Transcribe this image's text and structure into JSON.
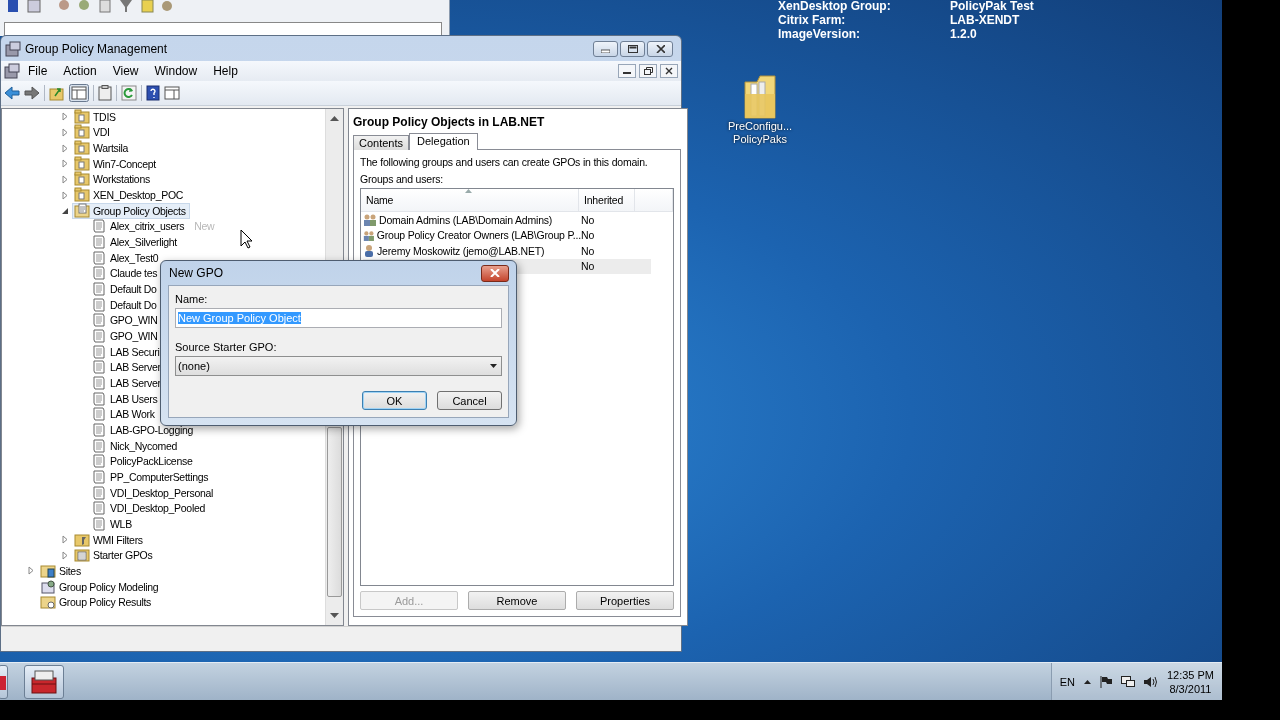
{
  "desktop_info": [
    {
      "label": "XenDesktop Group:",
      "value": "PolicyPak Test"
    },
    {
      "label": "Citrix Farm:",
      "value": "LAB-XENDT"
    },
    {
      "label": "ImageVersion:",
      "value": "1.2.0"
    }
  ],
  "desktop_icons": [
    {
      "label": "PreConfigu... PolicyPaks"
    }
  ],
  "window": {
    "title": "Group Policy Management",
    "menu": [
      "File",
      "Action",
      "View",
      "Window",
      "Help"
    ]
  },
  "tree": {
    "items": [
      {
        "kind": "continuation",
        "children": [
          {
            "label": "TDIS",
            "kind": "ou",
            "expanded": false,
            "selected": false
          },
          {
            "label": "VDI",
            "kind": "ou",
            "expanded": false,
            "selected": false
          },
          {
            "label": "Wartsila",
            "kind": "ou",
            "expanded": false,
            "selected": false
          },
          {
            "label": "Win7-Concept",
            "kind": "ou",
            "expanded": false,
            "selected": false
          },
          {
            "label": "Workstations",
            "kind": "ou",
            "expanded": false,
            "selected": false
          },
          {
            "label": "XEN_Desktop_POC",
            "kind": "ou",
            "expanded": false,
            "selected": false
          },
          {
            "label": "Group Policy Objects",
            "kind": "gpo_container",
            "expanded": true,
            "selected": true,
            "children": [
              {
                "label": "Alex_citrix_users",
                "kind": "gpo",
                "selected": false,
                "hint": "New"
              },
              {
                "label": "Alex_Silverlight",
                "kind": "gpo",
                "selected": false
              },
              {
                "label": "Alex_Test0",
                "kind": "gpo",
                "selected": false
              },
              {
                "label": "Claude tes",
                "kind": "gpo",
                "selected": false
              },
              {
                "label": "Default Do",
                "kind": "gpo",
                "selected": false
              },
              {
                "label": "Default Do",
                "kind": "gpo",
                "selected": false
              },
              {
                "label": "GPO_WIN",
                "kind": "gpo",
                "selected": false
              },
              {
                "label": "GPO_WIN",
                "kind": "gpo",
                "selected": false
              },
              {
                "label": "LAB Securi",
                "kind": "gpo",
                "selected": false
              },
              {
                "label": "LAB Server",
                "kind": "gpo",
                "selected": false
              },
              {
                "label": "LAB Server",
                "kind": "gpo",
                "selected": false
              },
              {
                "label": "LAB Users",
                "kind": "gpo",
                "selected": false
              },
              {
                "label": "LAB Work",
                "kind": "gpo",
                "selected": false
              },
              {
                "label": "LAB-GPO-Logging",
                "kind": "gpo",
                "selected": false
              },
              {
                "label": "Nick_Nycomed",
                "kind": "gpo",
                "selected": false
              },
              {
                "label": "PolicyPackLicense",
                "kind": "gpo",
                "selected": false
              },
              {
                "label": "PP_ComputerSettings",
                "kind": "gpo",
                "selected": false
              },
              {
                "label": "VDI_Desktop_Personal",
                "kind": "gpo",
                "selected": false
              },
              {
                "label": "VDI_Desktop_Pooled",
                "kind": "gpo",
                "selected": false
              },
              {
                "label": "WLB",
                "kind": "gpo",
                "selected": false
              }
            ]
          },
          {
            "label": "WMI Filters",
            "kind": "wmi",
            "expanded": false,
            "selected": false
          },
          {
            "label": "Starter GPOs",
            "kind": "starter",
            "expanded": false,
            "selected": false
          }
        ]
      },
      {
        "label": "Sites",
        "kind": "sites",
        "expanded": false,
        "selected": false
      },
      {
        "label": "Group Policy Modeling",
        "kind": "modeling",
        "selected": false
      },
      {
        "label": "Group Policy Results",
        "kind": "results",
        "selected": false
      }
    ]
  },
  "details": {
    "heading": "Group Policy Objects in LAB.NET",
    "tabs": [
      {
        "label": "Contents",
        "selected": false
      },
      {
        "label": "Delegation",
        "selected": true
      }
    ],
    "description": "The following groups and users can create GPOs in this domain.",
    "list_label": "Groups and users:",
    "columns": [
      "Name",
      "Inherited"
    ],
    "rows": [
      {
        "name": "Domain Admins (LAB\\Domain Admins)",
        "kind": "group",
        "inherited": "No",
        "selected": false
      },
      {
        "name": "Group Policy Creator Owners (LAB\\Group P...",
        "kind": "group",
        "inherited": "No",
        "selected": false
      },
      {
        "name": "Jeremy Moskowitz (jemo@LAB.NET)",
        "kind": "user",
        "inherited": "No",
        "selected": false
      },
      {
        "inherited": "No",
        "selected": true
      }
    ],
    "buttons": [
      {
        "label": "Add...",
        "disabled": true
      },
      {
        "label": "Remove",
        "disabled": false
      },
      {
        "label": "Properties",
        "disabled": false
      }
    ]
  },
  "dialog": {
    "title": "New GPO",
    "name_label": "Name:",
    "name_value": "New Group Policy Object",
    "name_value_selected": true,
    "source_label": "Source Starter GPO:",
    "source_value": "(none)",
    "buttons": [
      {
        "label": "OK",
        "default": true
      },
      {
        "label": "Cancel",
        "default": false
      }
    ]
  },
  "taskbar": {
    "language": "EN",
    "time": "12:35 PM",
    "date": "8/3/2011"
  }
}
